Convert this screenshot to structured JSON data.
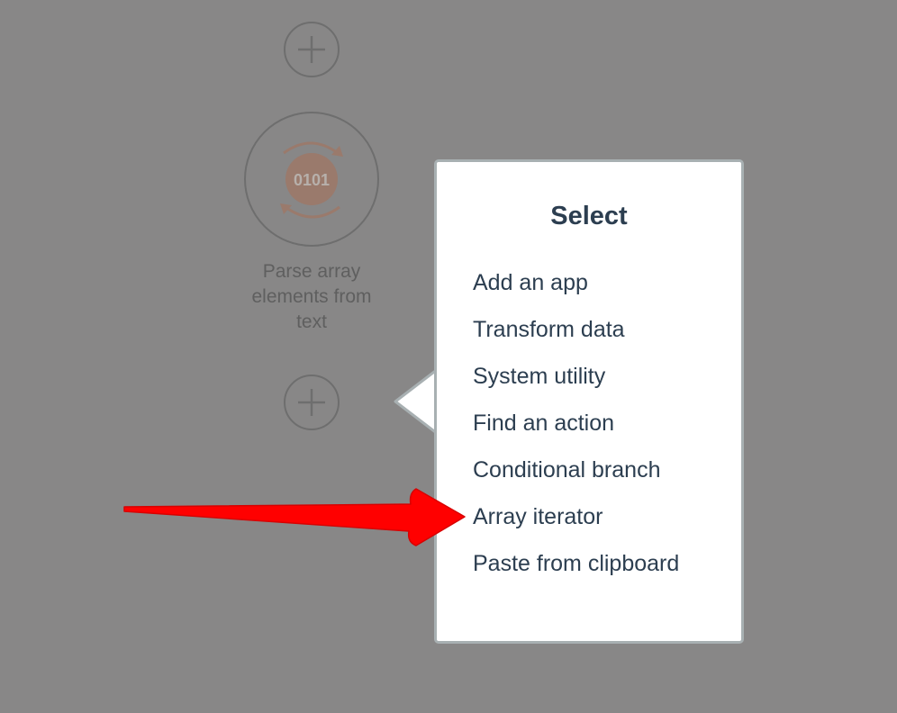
{
  "canvas": {
    "background": "#888787",
    "add_icon": "plus-icon"
  },
  "module": {
    "icon": "array-parser-icon",
    "badge_text": "0101",
    "label_lines": [
      "Parse array",
      "elements from",
      "text"
    ],
    "accent_color": "#9a7a6c"
  },
  "popover": {
    "title": "Select",
    "items": [
      {
        "label": "Add an app"
      },
      {
        "label": "Transform data"
      },
      {
        "label": "System utility"
      },
      {
        "label": "Find an action"
      },
      {
        "label": "Conditional branch"
      },
      {
        "label": "Array iterator"
      },
      {
        "label": "Paste from clipboard"
      }
    ]
  },
  "annotation": {
    "type": "arrow",
    "color": "#ff0000",
    "target": "Array iterator"
  }
}
